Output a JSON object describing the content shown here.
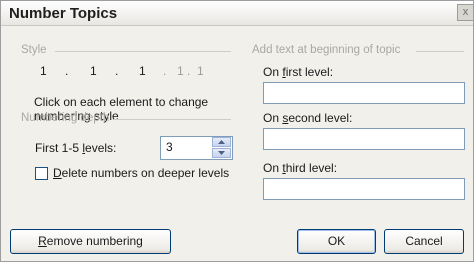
{
  "dialog": {
    "title": "Number Topics",
    "close_glyph": "x"
  },
  "style_section": {
    "label": "Style",
    "elements": [
      "1",
      ".",
      "1",
      ".",
      "1",
      ".",
      "1",
      ".",
      "1"
    ],
    "instructions": "Click on each element to change numbering style"
  },
  "depth_section": {
    "label": "Numbering depth",
    "levels_label_pre": "First 1-5 ",
    "levels_label_key": "l",
    "levels_label_post": "evels:",
    "levels_value": "3",
    "delete_checkbox_key": "D",
    "delete_checkbox_rest": "elete numbers on deeper levels",
    "delete_checked": false
  },
  "text_section": {
    "label": "Add text at beginning of topic",
    "first_level": {
      "pre": "On ",
      "key": "f",
      "post": "irst level:",
      "value": ""
    },
    "second_level": {
      "pre": "On ",
      "key": "s",
      "post": "econd level:",
      "value": ""
    },
    "third_level": {
      "pre": "On ",
      "key": "t",
      "post": "hird level:",
      "value": ""
    }
  },
  "buttons": {
    "remove_key": "R",
    "remove_rest": "emove numbering",
    "ok": "OK",
    "cancel": "Cancel"
  }
}
